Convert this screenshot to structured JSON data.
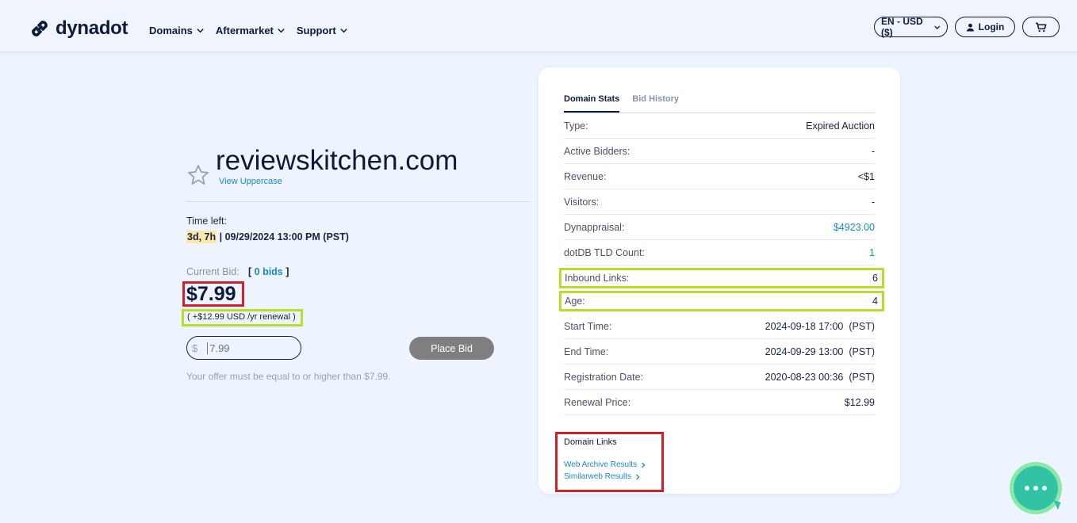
{
  "header": {
    "brand": "dynadot",
    "nav": [
      {
        "label": "Domains"
      },
      {
        "label": "Aftermarket"
      },
      {
        "label": "Support"
      }
    ],
    "language": "EN - USD ($)",
    "login": "Login"
  },
  "domain": {
    "name": "reviewskitchen.com",
    "view_uppercase": "View Uppercase",
    "time_left_label": "Time left:",
    "time_left_short": "3d, 7h",
    "time_left_rest": "| 09/29/2024 13:00 PM (PST)",
    "current_bid_label": "Current Bid:",
    "bids_open": "[ ",
    "bids_link": "0 bids",
    "bids_close": " ]",
    "price": "$7.99",
    "renewal": "( +$12.99 USD /yr renewal )",
    "currency_symbol": "$",
    "bid_placeholder": "7.99",
    "place_bid": "Place Bid",
    "offer_note": "Your offer must be equal to or higher than $7.99."
  },
  "stats_card": {
    "tabs": [
      {
        "label": "Domain Stats",
        "active": true
      },
      {
        "label": "Bid History",
        "active": false
      }
    ],
    "rows": [
      {
        "label": "Type:",
        "value": "Expired Auction"
      },
      {
        "label": "Active Bidders:",
        "value": "-"
      },
      {
        "label": "Revenue:",
        "value": "<$1"
      },
      {
        "label": "Visitors:",
        "value": "-"
      },
      {
        "label": "Dynappraisal:",
        "value": "$4923.00"
      },
      {
        "label": "dotDB TLD Count:",
        "value": "1"
      },
      {
        "label": "Inbound Links:",
        "value": "6"
      },
      {
        "label": "Age:",
        "value": "4"
      },
      {
        "label": "Start Time:",
        "value": "2024-09-18 17:00",
        "tz": "(PST)"
      },
      {
        "label": "End Time:",
        "value": "2024-09-29 13:00",
        "tz": "(PST)"
      },
      {
        "label": "Registration Date:",
        "value": "2020-08-23 00:36",
        "tz": "(PST)"
      },
      {
        "label": "Renewal Price:",
        "value": "$12.99"
      }
    ],
    "links_title": "Domain Links",
    "links": [
      {
        "label": "Web Archive Results"
      },
      {
        "label": "Similarweb Results"
      }
    ]
  },
  "colors": {
    "accent_link": "#1b8ac2",
    "highlight_red": "#d4202a",
    "highlight_green": "#b8dd2a",
    "chat": "#32c3a6"
  }
}
